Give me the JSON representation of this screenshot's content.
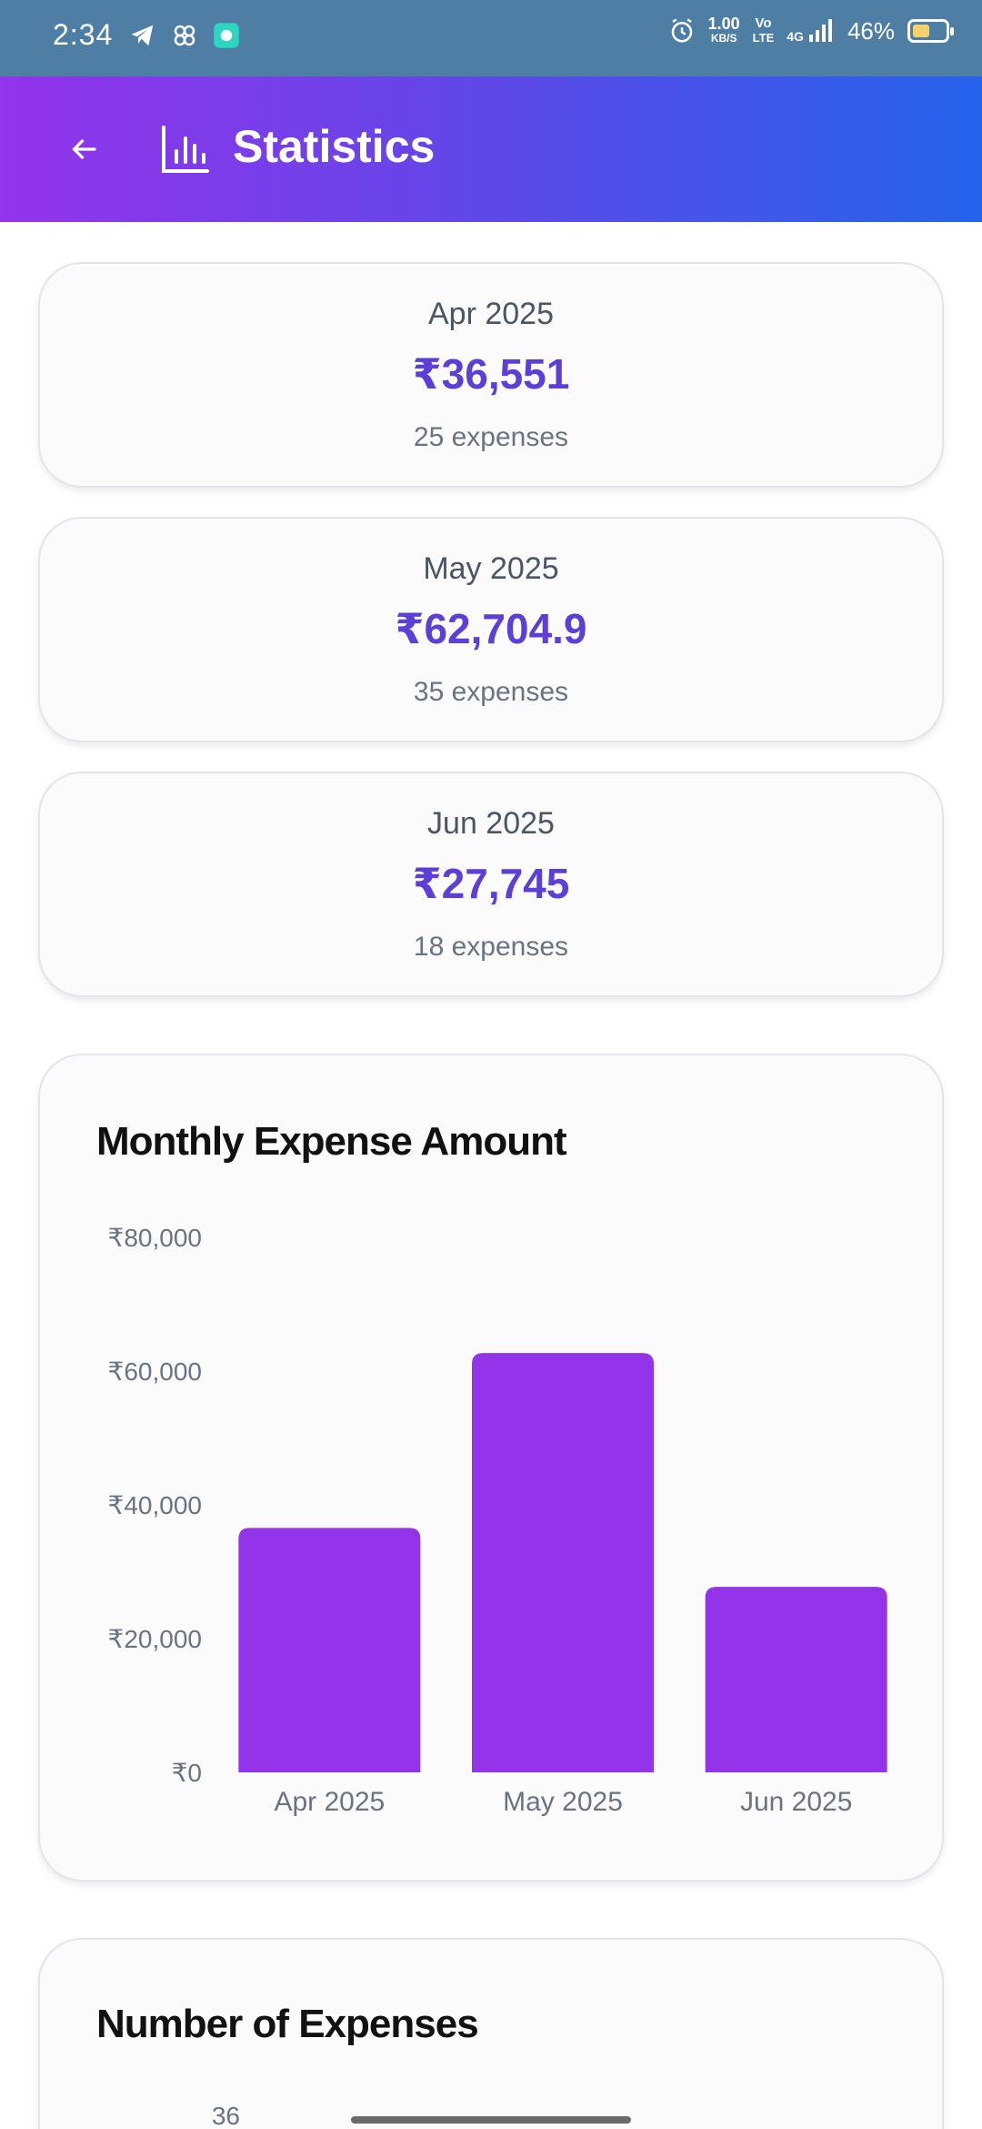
{
  "status_bar": {
    "time": "2:34",
    "net_speed_value": "1.00",
    "net_speed_unit": "KB/S",
    "volte_top": "Vo",
    "volte_bottom": "LTE",
    "network": "4G",
    "battery": "46%",
    "icons": [
      "telegram-icon",
      "pinwheel-icon",
      "chat-app-icon",
      "alarm-icon",
      "signal-icon",
      "battery-icon"
    ]
  },
  "app_bar": {
    "title": "Statistics",
    "gradient_start": "#9333ea",
    "gradient_end": "#2563eb"
  },
  "summary_cards": [
    {
      "month": "Apr 2025",
      "amount": "₹36,551",
      "count": "25 expenses"
    },
    {
      "month": "May 2025",
      "amount": "₹62,704.9",
      "count": "35 expenses"
    },
    {
      "month": "Jun 2025",
      "amount": "₹27,745",
      "count": "18 expenses"
    }
  ],
  "amount_chart": {
    "title": "Monthly Expense Amount",
    "bar_color": "#9333ea",
    "chart_data": {
      "type": "bar",
      "categories": [
        "Apr 2025",
        "May 2025",
        "Jun 2025"
      ],
      "values": [
        36551,
        62704.9,
        27745
      ],
      "ylim": [
        0,
        80000
      ],
      "y_ticks": [
        "₹0",
        "₹20,000",
        "₹40,000",
        "₹60,000",
        "₹80,000"
      ],
      "y_tick_values": [
        0,
        20000,
        40000,
        60000,
        80000
      ],
      "grid": false
    }
  },
  "count_chart": {
    "title": "Number of Expenses",
    "visible_y_tick": "36"
  }
}
